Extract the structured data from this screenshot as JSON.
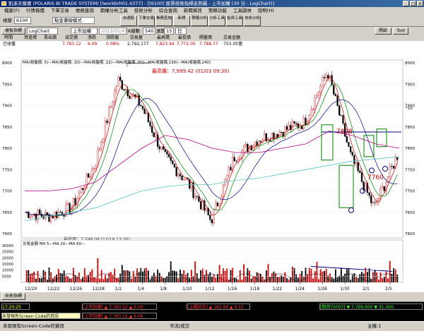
{
  "window": {
    "title": "凱涿夫慷寷 (POLARIS BI TRADE SYSTEM) [lworkbrh01.4377] - [[6100] 股票技術指標走勢圖 - 上市加權 (30 分 - LogChart)]"
  },
  "menu": [
    "檔案(F)",
    "行情報價",
    "下單交易",
    "帳務查詢",
    "期權分析工具",
    "技術分析",
    "綜合查詢",
    "新聞資訊",
    "策略功能",
    "工具園林",
    "說明(H)"
  ],
  "toolbar": {
    "sheet_label": "視窗",
    "sheet_code": "6100",
    "layout_select": "點金畫線模式",
    "buttons": [
      "自選股",
      "下單交易",
      "帳務查詢",
      "新聞",
      "期權分析",
      "分析工具",
      "投資工具",
      "技術分析"
    ],
    "right_buttons": [
      "開啟",
      "Tool"
    ]
  },
  "row2": {
    "label": "標的",
    "code": "上市加權",
    "date_field": "2013/01/01",
    "period_label": "K線數",
    "period_value": "540",
    "interval_label": "週期",
    "interval_value": "15",
    "unit_value": "日",
    "chart_btn": "樣板指標",
    "chart_type": "LogChart"
  },
  "info": {
    "headers": [
      "時間",
      "買進價",
      "賣出價",
      "成交價",
      "漲跌",
      "漲跌幅",
      "交易量",
      "最高價",
      "最低價",
      "開盤價",
      "交易金額"
    ],
    "values": [
      "已收盤",
      "",
      "",
      "7,783.12",
      "6.09",
      "0.08%",
      "2,792,177",
      "7,823.94",
      "7,772.05",
      "7,788.77",
      "753.05億"
    ]
  },
  "chart": {
    "ma_legend": "MA(收盤價, 5)—MA(收盤價, 10)—MA(收盤價, 22)—MA(收盤價, 60)—MA(收盤價,130)—MA(收盤價,240)",
    "high_label": "最高價：7,999.42 (01/03 09:30)",
    "low_label": "最低價：7,598.09 (12/19 13:30)",
    "resist_label": "7838",
    "support_label": "7760",
    "volume_legend": "交易金額 MA   5—MA  20—MA  60—",
    "y_ticks": [
      "8000",
      "7950",
      "7900",
      "7850",
      "7800",
      "7750",
      "7700",
      "7650",
      "7600"
    ],
    "vol_ticks": [
      "30000",
      "25000",
      "20000",
      "15000",
      "10000",
      "5000"
    ],
    "x_ticks": [
      "12/20",
      "12/22",
      "12/26",
      "12/28",
      "1/2",
      "1/4",
      "1/8",
      "1/10",
      "1/12",
      "1/16",
      "1/18",
      "1/22",
      "1/24",
      "1/26",
      "1/30",
      "2/1",
      "2/5"
    ],
    "unit_label": "*10",
    "colors": {
      "up": "#cc0000",
      "down": "#000000",
      "ma5": "#c00000",
      "ma10": "#008000",
      "ma22": "#000080",
      "ma60": "#b00080",
      "ma130": "#60c0c0",
      "ma240": "#00c0ff",
      "box": "#008000",
      "hline": "#000080"
    }
  },
  "chart_data": {
    "type": "line",
    "title": "",
    "ylim": [
      7600,
      8000
    ],
    "x": [
      "12/20",
      "12/22",
      "12/26",
      "12/28",
      "1/2",
      "1/4",
      "1/8",
      "1/10",
      "1/12",
      "1/16",
      "1/18",
      "1/22",
      "1/24",
      "1/26",
      "1/30",
      "2/1",
      "2/5"
    ],
    "series": [
      {
        "name": "Close",
        "values": [
          7650,
          7640,
          7660,
          7760,
          7960,
          7900,
          7780,
          7720,
          7630,
          7780,
          7820,
          7840,
          7860,
          7980,
          7780,
          7660,
          7783
        ]
      },
      {
        "name": "MA(收盤價, 60)",
        "values": [
          7700,
          7700,
          7705,
          7720,
          7760,
          7800,
          7830,
          7820,
          7800,
          7790,
          7790,
          7800,
          7810,
          7840,
          7830,
          7810,
          7800
        ]
      },
      {
        "name": "MA(收盤價,130)",
        "values": [
          7630,
          7640,
          7650,
          7660,
          7680,
          7700,
          7710,
          7715,
          7715,
          7725,
          7730,
          7740,
          7750,
          7760,
          7770,
          7775,
          7780
        ]
      }
    ]
  },
  "bottom": {
    "tabs": [
      "技術指標"
    ],
    "time": "17:20:25",
    "quotes": [
      "[上市加權] ▲ 7,783.12 ▲ 6.09",
      "[上櫃綜合] ▲ 162.69 ▲ 0.55",
      "[期貨TXF07] ▼ 7,799.000 ▼ 31.000",
      "[上市加權] ▲ 7,783.12 ▲ 6.09"
    ],
    "marquee": "未發現有Screen-Code的資訊",
    "status_mid": "市況/成交",
    "status_right": "主機:1"
  }
}
